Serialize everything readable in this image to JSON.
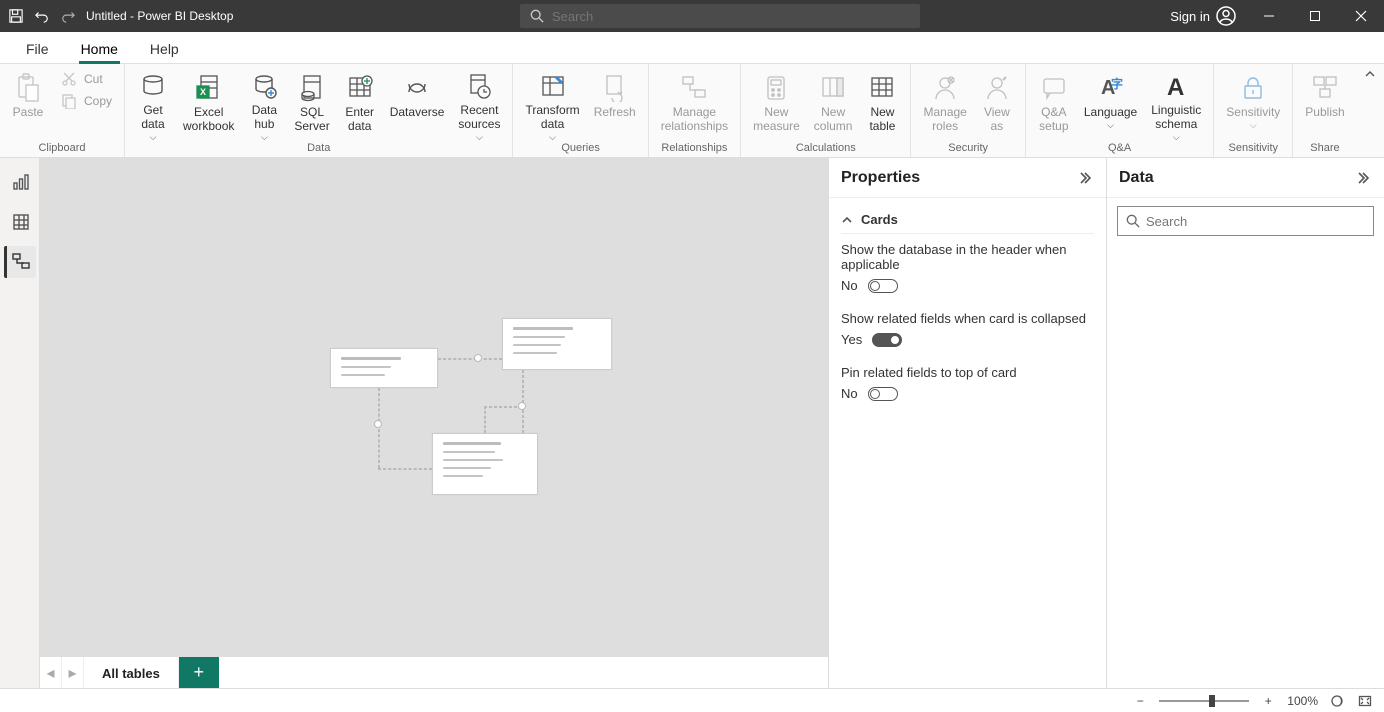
{
  "titlebar": {
    "title": "Untitled - Power BI Desktop",
    "search_placeholder": "Search",
    "signin": "Sign in"
  },
  "tabs": {
    "file": "File",
    "home": "Home",
    "help": "Help"
  },
  "ribbon": {
    "clipboard": {
      "paste": "Paste",
      "cut": "Cut",
      "copy": "Copy",
      "group": "Clipboard"
    },
    "data": {
      "get_data": "Get\ndata",
      "excel": "Excel\nworkbook",
      "data_hub": "Data\nhub",
      "sql": "SQL\nServer",
      "enter": "Enter\ndata",
      "dataverse": "Dataverse",
      "recent": "Recent\nsources",
      "group": "Data"
    },
    "queries": {
      "transform": "Transform\ndata",
      "refresh": "Refresh",
      "group": "Queries"
    },
    "relationships": {
      "manage": "Manage\nrelationships",
      "group": "Relationships"
    },
    "calculations": {
      "measure": "New\nmeasure",
      "column": "New\ncolumn",
      "table": "New\ntable",
      "group": "Calculations"
    },
    "security": {
      "roles": "Manage\nroles",
      "view": "View\nas",
      "group": "Security"
    },
    "qa": {
      "setup": "Q&A\nsetup",
      "language": "Language",
      "schema": "Linguistic\nschema",
      "group": "Q&A"
    },
    "sensitivity": {
      "sensitivity": "Sensitivity",
      "group": "Sensitivity"
    },
    "share": {
      "publish": "Publish",
      "group": "Share"
    }
  },
  "pages": {
    "all_tables": "All tables"
  },
  "properties": {
    "title": "Properties",
    "section": "Cards",
    "opt1": {
      "label": "Show the database in the header when applicable",
      "value": "No",
      "on": false
    },
    "opt2": {
      "label": "Show related fields when card is collapsed",
      "value": "Yes",
      "on": true
    },
    "opt3": {
      "label": "Pin related fields to top of card",
      "value": "No",
      "on": false
    }
  },
  "data_panel": {
    "title": "Data",
    "search_placeholder": "Search"
  },
  "status": {
    "zoom": "100%"
  }
}
